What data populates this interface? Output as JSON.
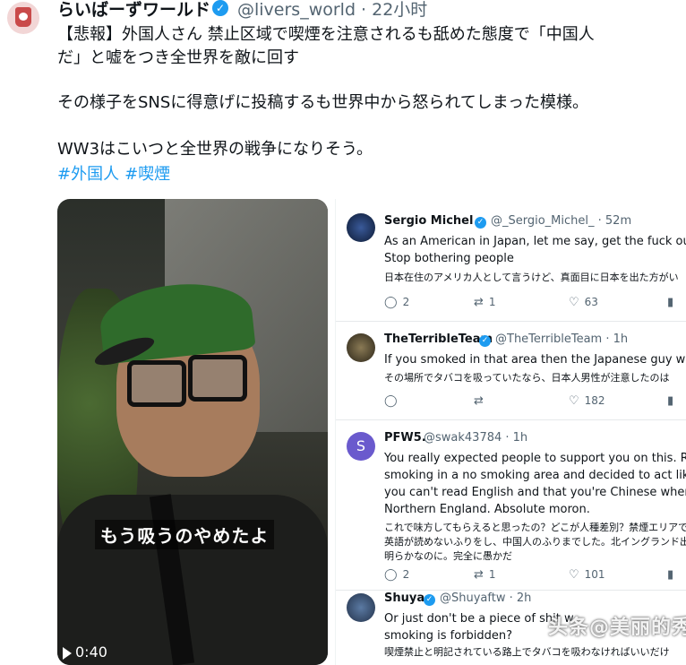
{
  "tweet": {
    "author_name": "らいばーずワールド",
    "handle_time": "@livers_world · 22小时",
    "verified_icon": "verified-badge-icon",
    "line1": "【悲報】外国人さん 禁止区域で喫煙を注意されるも舐めた態度で「中国人",
    "line2": "だ」と嘘をつき全世界を敵に回す",
    "line3": "その様子をSNSに得意げに投稿するも世界中から怒られてしまった模様。",
    "line4": "WW3はこいつと全世界の戦争になりそう。",
    "hashtags": [
      "#外国人",
      "#喫煙"
    ]
  },
  "video": {
    "subtitle": "もう吸うのやめたよ",
    "time": "0:40"
  },
  "replies": [
    {
      "name": "Sergio Michel",
      "handle": "@_Sergio_Michel_ · 52m",
      "lines": [
        "As an American in Japan, let me say, get the fuck out of J",
        "Stop bothering people"
      ],
      "jp": [
        "日本在住のアメリカ人として言うけど、真面目に日本を出た方がい"
      ],
      "counts": {
        "reply": "2",
        "repost": "1",
        "like": "63"
      }
    },
    {
      "name": "TheTerribleTeam",
      "handle": "@TheTerribleTeam · 1h",
      "lines": [
        "If you smoked in that area then the Japanese guy was rig"
      ],
      "jp": [
        "その場所でタバコを吸っていたなら、日本人男性が注意したのは"
      ],
      "counts": {
        "reply": "",
        "repost": "",
        "like": "182"
      }
    },
    {
      "name": "PFW5.",
      "handle": "@swak43784 · 1h",
      "avatar_letter": "S",
      "lines": [
        "You really expected people to support you on this. Racism",
        "smoking in a no smoking area and decided to act like a cur",
        "you can't read English and that you're Chinese  when you're",
        "Northern England.  Absolute moron."
      ],
      "jp": [
        "これで味方してもらえると思ったの？どこが人種差別？禁煙エリアで喫",
        "英語が読めないふりをし、中国人のふりまでした。北イングランド出身",
        "明らかなのに。完全に愚かだ"
      ],
      "counts": {
        "reply": "2",
        "repost": "1",
        "like": "101"
      }
    },
    {
      "name": "Shuya",
      "handle": "@Shuyaftw · 2h",
      "lines": [
        "Or just don't be a piece of shit w",
        "smoking is forbidden?"
      ],
      "jp": [
        "喫煙禁止と明記されている路上でタバコを吸わなければいいだけ"
      ],
      "counts": {
        "reply": "",
        "repost": "",
        "like": ""
      }
    }
  ],
  "watermark": "头条@美丽的秀秀",
  "colors": {
    "accent": "#1d9bf0",
    "text": "#0f1419",
    "muted": "#536471"
  }
}
